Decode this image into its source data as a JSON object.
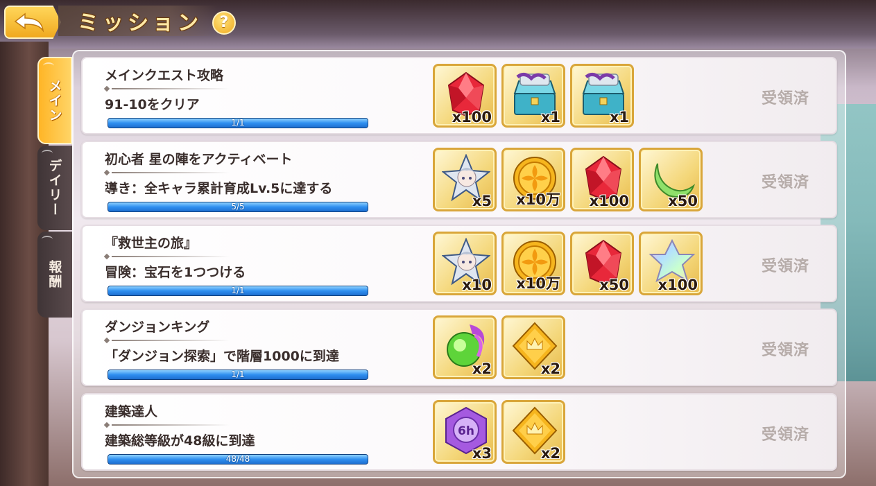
{
  "header": {
    "title": "ミッション",
    "help_glyph": "?"
  },
  "tabs": [
    {
      "label": "メイン",
      "active": true
    },
    {
      "label": "デイリー",
      "active": false
    },
    {
      "label": "報酬",
      "active": false
    }
  ],
  "missions": [
    {
      "title": "メインクエスト攻略",
      "description": "91-10をクリア",
      "progress_text": "1/1",
      "progress_fraction": 1,
      "status": "受領済",
      "rewards": [
        {
          "icon": "red-gem-icon",
          "qty": "x100"
        },
        {
          "icon": "treasure-chest-icon",
          "qty": "x1"
        },
        {
          "icon": "treasure-chest-icon",
          "qty": "x1"
        }
      ]
    },
    {
      "title": "初心者 星の陣をアクティベート",
      "description": "導き：全キャラ累計育成Lv.5に達する",
      "progress_text": "5/5",
      "progress_fraction": 1,
      "status": "受領済",
      "rewards": [
        {
          "icon": "character-shard-icon",
          "qty": "x5"
        },
        {
          "icon": "gold-coin-icon",
          "qty": "x10万"
        },
        {
          "icon": "red-gem-icon",
          "qty": "x100"
        },
        {
          "icon": "green-crescent-icon",
          "qty": "x50"
        }
      ]
    },
    {
      "title": "『救世主の旅』",
      "description": "冒険：宝石を1つつける",
      "progress_text": "1/1",
      "progress_fraction": 1,
      "status": "受領済",
      "rewards": [
        {
          "icon": "character-shard-icon",
          "qty": "x10"
        },
        {
          "icon": "gold-coin-icon",
          "qty": "x10万"
        },
        {
          "icon": "red-gem-icon",
          "qty": "x50"
        },
        {
          "icon": "rainbow-star-icon",
          "qty": "x100"
        }
      ]
    },
    {
      "title": "ダンジョンキング",
      "description": "「ダンジョン探索」で階層1000に到達",
      "progress_text": "1/1",
      "progress_fraction": 1,
      "status": "受領済",
      "rewards": [
        {
          "icon": "green-flame-orb-icon",
          "qty": "x2"
        },
        {
          "icon": "gold-crown-card-icon",
          "qty": "x2"
        }
      ]
    },
    {
      "title": "建築達人",
      "description": "建築総等級が48級に到達",
      "progress_text": "48/48",
      "progress_fraction": 1,
      "status": "受領済",
      "rewards": [
        {
          "icon": "purple-6h-timer-icon",
          "qty": "x3",
          "label": "6h"
        },
        {
          "icon": "gold-crown-card-icon",
          "qty": "x2"
        }
      ]
    }
  ],
  "colors": {
    "accent_gold": "#f0a91f",
    "progress_blue": "#2f8ff0",
    "status_gray": "#b6aca9"
  }
}
